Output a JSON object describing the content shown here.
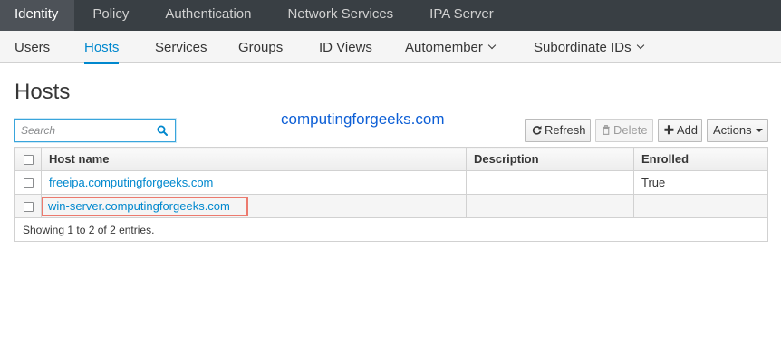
{
  "topnav": {
    "tabs": [
      "Identity",
      "Policy",
      "Authentication",
      "Network Services",
      "IPA Server"
    ],
    "active": "Identity"
  },
  "subnav": {
    "items": [
      "Users",
      "Hosts",
      "Services",
      "Groups",
      "ID Views",
      "Automember",
      "Subordinate IDs"
    ],
    "active": "Hosts"
  },
  "page": {
    "title": "Hosts",
    "watermark": "computingforgeeks.com"
  },
  "search": {
    "placeholder": "Search",
    "value": ""
  },
  "toolbar": {
    "refresh_label": "Refresh",
    "delete_label": "Delete",
    "add_label": "Add",
    "actions_label": "Actions"
  },
  "table": {
    "columns": [
      "Host name",
      "Description",
      "Enrolled"
    ],
    "rows": [
      {
        "host": "freeipa.computingforgeeks.com",
        "description": "",
        "enrolled": "True",
        "highlighted": false
      },
      {
        "host": "win-server.computingforgeeks.com",
        "description": "",
        "enrolled": "",
        "highlighted": true
      }
    ],
    "footer": "Showing 1 to 2 of 2 entries."
  },
  "colors": {
    "topnav_bg": "#393f44",
    "accent": "#0088ce",
    "highlight_border": "#ec7a6e",
    "watermark": "#0d5fd6"
  },
  "icons": {
    "search": "search-icon",
    "refresh": "refresh-icon",
    "delete": "trash-icon",
    "add": "plus-icon",
    "dropdown": "chevron-down-icon"
  }
}
